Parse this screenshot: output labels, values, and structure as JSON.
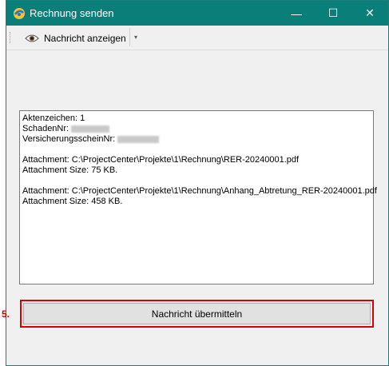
{
  "window": {
    "title": "Rechnung senden",
    "minimize": "—",
    "maximize": "☐",
    "close": "✕"
  },
  "toolbar": {
    "show_message_label": "Nachricht anzeigen",
    "dropdown_arrow": "▾"
  },
  "log": {
    "aktenzeichen": "Aktenzeichen: 1",
    "schadennr_label": "SchadenNr:",
    "versicherungsschein_label": "VersicherungsscheinNr:",
    "attachment1_path": "Attachment: C:\\ProjectCenter\\Projekte\\1\\Rechnung\\RER-20240001.pdf",
    "attachment1_size": "Attachment Size: 75 KB.",
    "attachment2_path": "Attachment: C:\\ProjectCenter\\Projekte\\1\\Rechnung\\Anhang_Abtretung_RER-20240001.pdf",
    "attachment2_size": "Attachment Size: 458 KB."
  },
  "step_label": "5.",
  "send_button_label": "Nachricht übermitteln",
  "colors": {
    "titlebar": "#0a7f7a",
    "highlight": "#d80000"
  }
}
